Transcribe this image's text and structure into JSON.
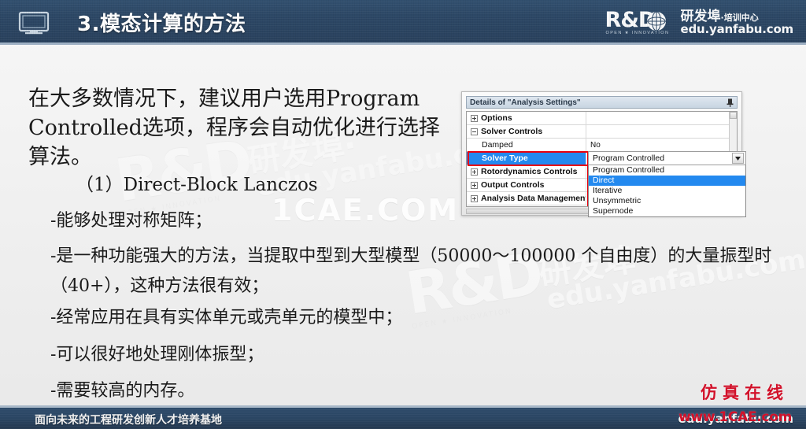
{
  "header": {
    "icon": "monitor-icon",
    "title": "3.模态计算的方法",
    "bg_color": "#2c4765",
    "logo": {
      "mark": "R&D",
      "tagline": "OPEN ★ INNOVATION",
      "cn_name": "研发埠",
      "cn_sub": "·培训中心",
      "url": "edu.yanfabu.com"
    }
  },
  "body": {
    "lead": "在大多数情况下，建议用户选用Program Controlled选项，程序会自动优化进行选择算法。",
    "item_1": "（1）Direct-Block Lanczos",
    "bullets": [
      "-能够处理对称矩阵；",
      "-是一种功能强大的方法，当提取中型到大型模型（50000～100000 个自由度）的大量振型时（40+），这种方法很有效；",
      "-经常应用在具有实体单元或壳单元的模型中；",
      "-可以很好地处理刚体振型；",
      "-需要较高的内存。"
    ]
  },
  "dialog": {
    "title": "Details of \"Analysis Settings\"",
    "pin_icon": "pin-icon",
    "rows": [
      {
        "label": "Options",
        "value": "",
        "expander": "plus",
        "bold": true,
        "indent": false,
        "selected": false
      },
      {
        "label": "Solver Controls",
        "value": "",
        "expander": "minus",
        "bold": true,
        "indent": false,
        "selected": false
      },
      {
        "label": "Damped",
        "value": "No",
        "expander": "none",
        "bold": false,
        "indent": true,
        "selected": false
      },
      {
        "label": "Solver Type",
        "value": "",
        "expander": "none",
        "bold": false,
        "indent": true,
        "selected": true
      },
      {
        "label": "Rotordynamics Controls",
        "value": "",
        "expander": "plus",
        "bold": true,
        "indent": false,
        "selected": false
      },
      {
        "label": "Output Controls",
        "value": "",
        "expander": "plus",
        "bold": true,
        "indent": false,
        "selected": false
      },
      {
        "label": "Analysis Data Management",
        "value": "",
        "expander": "plus",
        "bold": true,
        "indent": false,
        "selected": false
      }
    ],
    "dropdown": {
      "selected_value": "Program Controlled",
      "options": [
        {
          "label": "Program Controlled",
          "highlighted": false
        },
        {
          "label": "Direct",
          "highlighted": true
        },
        {
          "label": "Iterative",
          "highlighted": false
        },
        {
          "label": "Unsymmetric",
          "highlighted": false
        },
        {
          "label": "Supernode",
          "highlighted": false
        }
      ],
      "arrow_icon": "chevron-down-icon"
    },
    "highlight_color": "#e8000d",
    "selection_color": "#2389ef"
  },
  "watermarks": {
    "center_rd": "R&D",
    "center_tagline": "OPEN ★ INNOVATION",
    "center_cn": "研发埠·",
    "center_url": "edu.yanfabu.com",
    "cae": "1CAE.COM",
    "red_cn": "仿真在线",
    "red_url": "www.1CAE.com",
    "red_color": "#d2112a"
  },
  "footer": {
    "left": "面向未来的工程研发创新人才培养基地",
    "right": "edu.yanfabu.com"
  }
}
